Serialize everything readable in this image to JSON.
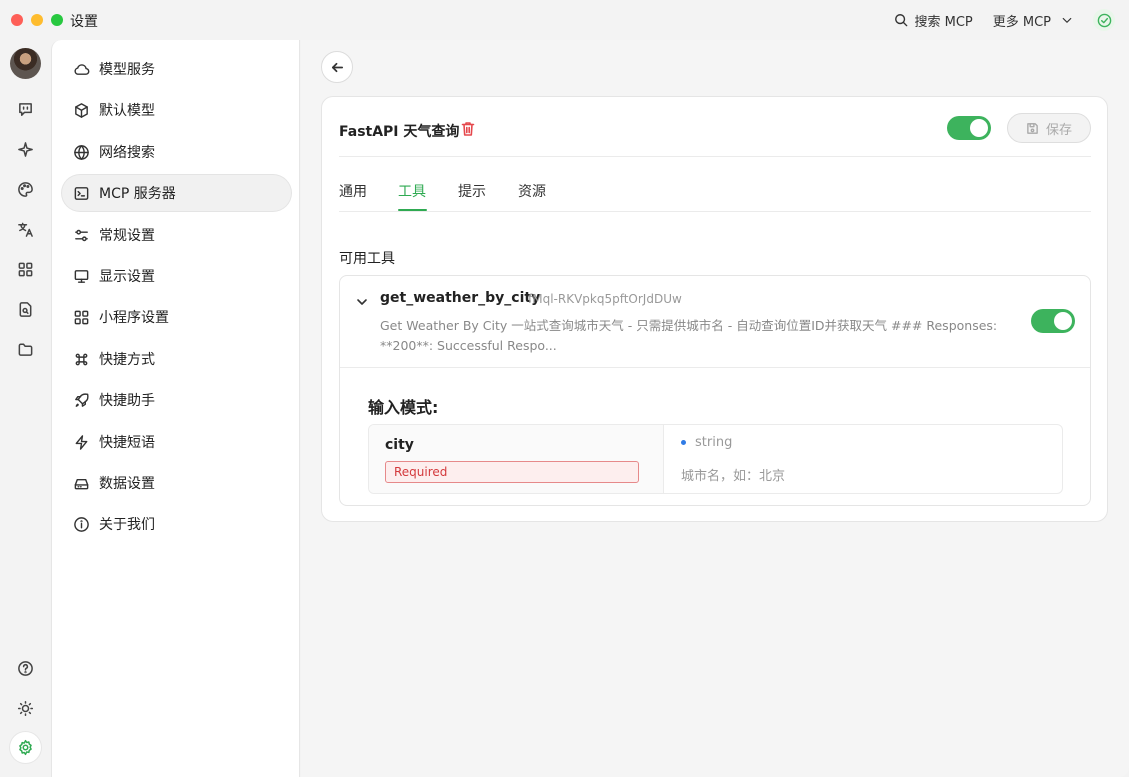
{
  "window": {
    "title": "设置"
  },
  "titlebar": {
    "search_mcp": "搜索 MCP",
    "more_mcp": "更多 MCP"
  },
  "rail": {
    "icons": [
      "chat-icon",
      "sparkle-icon",
      "palette-icon",
      "translate-icon",
      "apps-icon",
      "document-search-icon",
      "folder-icon",
      "help-icon",
      "theme-icon",
      "settings-icon"
    ]
  },
  "sidebar": {
    "items": [
      {
        "label": "模型服务",
        "icon": "cloud-icon"
      },
      {
        "label": "默认模型",
        "icon": "cube-icon"
      },
      {
        "label": "网络搜索",
        "icon": "globe-icon"
      },
      {
        "label": "MCP 服务器",
        "icon": "terminal-icon"
      },
      {
        "label": "常规设置",
        "icon": "sliders-icon"
      },
      {
        "label": "显示设置",
        "icon": "monitor-icon"
      },
      {
        "label": "小程序设置",
        "icon": "grid-icon"
      },
      {
        "label": "快捷方式",
        "icon": "command-icon"
      },
      {
        "label": "快捷助手",
        "icon": "rocket-icon"
      },
      {
        "label": "快捷短语",
        "icon": "zap-icon"
      },
      {
        "label": "数据设置",
        "icon": "drive-icon"
      },
      {
        "label": "关于我们",
        "icon": "info-icon"
      }
    ],
    "active_index": 3
  },
  "server": {
    "name": "FastAPI 天气查询",
    "enabled": true,
    "save_label": "保存"
  },
  "tabs": [
    {
      "label": "通用"
    },
    {
      "label": "工具"
    },
    {
      "label": "提示"
    },
    {
      "label": "资源"
    }
  ],
  "active_tab": "工具",
  "tools_section": {
    "label": "可用工具",
    "tool": {
      "name": "get_weather_by_city",
      "id": "fMql-RKVpkq5pftOrJdDUw",
      "description": "Get Weather By City 一站式查询城市天气 - 只需提供城市名 - 自动查询位置ID并获取天气 ### Responses: **200**: Successful Respo...",
      "enabled": true,
      "schema_title": "输入模式:",
      "params": [
        {
          "name": "city",
          "required_label": "Required",
          "type": "string",
          "description": "城市名，如：北京"
        }
      ]
    }
  },
  "colors": {
    "accent": "#2faa52",
    "danger": "#e5484d",
    "type_dot": "#2f7be5"
  }
}
